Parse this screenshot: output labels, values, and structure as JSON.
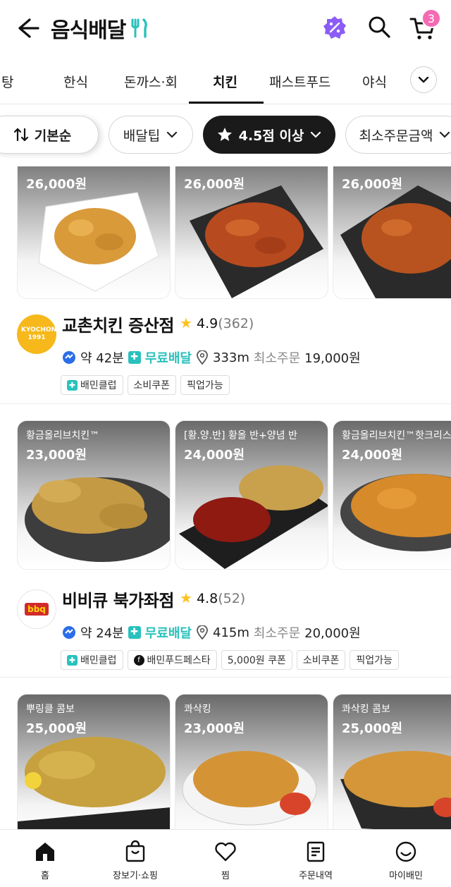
{
  "header": {
    "title": "음식배달",
    "cart_count": "3"
  },
  "tabs": [
    {
      "label": "·탕"
    },
    {
      "label": "한식"
    },
    {
      "label": "돈까스·회"
    },
    {
      "label": "치킨",
      "active": true
    },
    {
      "label": "패스트푸드"
    },
    {
      "label": "야식"
    }
  ],
  "filters": {
    "sort": "기본순",
    "delivery_tip": "배달팁",
    "rating": "4.5점 이상",
    "min_order": "최소주문금액"
  },
  "row1": [
    {
      "name": "",
      "price": "26,000원"
    },
    {
      "name": "",
      "price": "26,000원"
    },
    {
      "name": "",
      "price": "26,000원"
    }
  ],
  "store1": {
    "logo_text": "KYOCHON 1991",
    "name": "교촌치킨 증산점",
    "rating": "4.9",
    "reviews": "(362)",
    "time": "약 42분",
    "free": "무료배달",
    "distance": "333m",
    "min_label": "최소주문",
    "min_amount": "19,000원",
    "tags": [
      "배민클럽",
      "소비쿠폰",
      "픽업가능"
    ]
  },
  "row2": [
    {
      "name": "황금올리브치킨™",
      "price": "23,000원"
    },
    {
      "name": "[황.양.반] 황올 반+양념 반",
      "price": "24,000원"
    },
    {
      "name": "황금올리브치킨™핫크리스",
      "price": "24,000원"
    }
  ],
  "store2": {
    "logo_text": "bbq",
    "name": "비비큐 북가좌점",
    "rating": "4.8",
    "reviews": "(52)",
    "time": "약 24분",
    "free": "무료배달",
    "distance": "415m",
    "min_label": "최소주문",
    "min_amount": "20,000원",
    "tags": [
      "배민클럽",
      "배민푸드페스타",
      "5,000원 쿠폰",
      "소비쿠폰",
      "픽업가능"
    ]
  },
  "row3": [
    {
      "name": "뿌링클 콤보",
      "price": "25,000원"
    },
    {
      "name": "콰삭킹",
      "price": "23,000원"
    },
    {
      "name": "콰삭킹 콤보",
      "price": "25,000원"
    }
  ],
  "bottom_nav": [
    {
      "label": "홈",
      "icon": "home-icon"
    },
    {
      "label": "장보기·쇼핑",
      "icon": "shopping-bag-icon"
    },
    {
      "label": "찜",
      "icon": "heart-icon"
    },
    {
      "label": "주문내역",
      "icon": "receipt-icon"
    },
    {
      "label": "마이배민",
      "icon": "smile-icon"
    }
  ],
  "colors": {
    "accent": "#2ac1bc",
    "badge": "#f46bb3",
    "star": "#ffc11e",
    "promo": "#8b5cf6"
  }
}
